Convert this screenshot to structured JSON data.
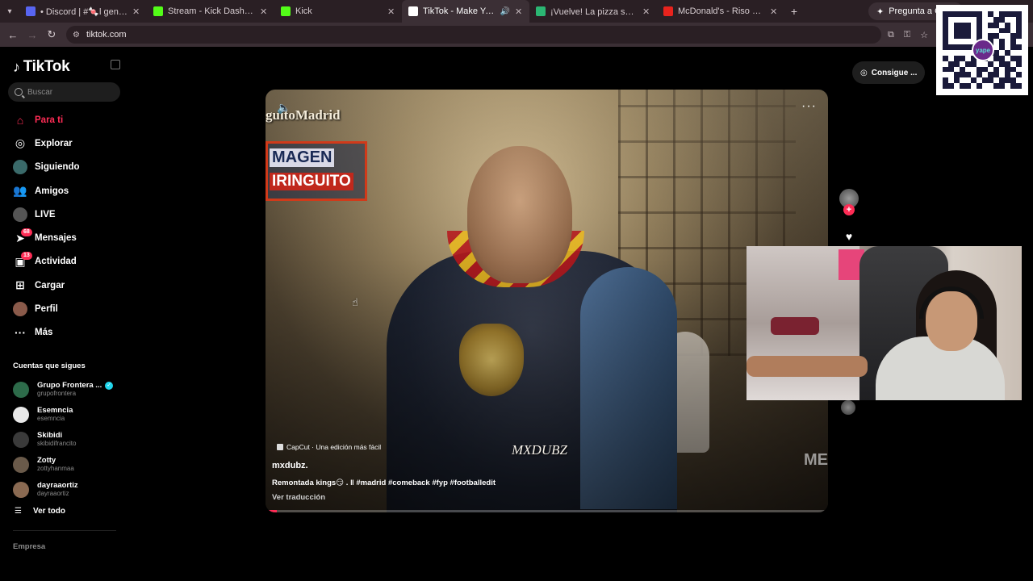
{
  "browser": {
    "tabs": [
      {
        "title": "• Discord | #🍬l general | Clou",
        "favicon_color": "#5865f2",
        "active": false
      },
      {
        "title": "Stream - Kick Dashboard",
        "favicon_color": "#53fc18",
        "active": false
      },
      {
        "title": "Kick",
        "favicon_color": "#53fc18",
        "active": false
      },
      {
        "title": "TikTok - Make Your Day",
        "favicon_color": "#ffffff",
        "active": true
      },
      {
        "title": "¡Vuelve! La pizza se enfría 🍕🔵",
        "favicon_color": "#2bb673",
        "active": false
      },
      {
        "title": "McDonald's - Riso Precios y Me",
        "favicon_color": "#e8231d",
        "active": false
      }
    ],
    "gemini_label": "Pregunta a Gemi",
    "url": "tiktok.com"
  },
  "qr": {
    "logo_text": "yape"
  },
  "sidebar": {
    "brand": "TikTok",
    "search_placeholder": "Buscar",
    "nav": [
      {
        "label": "Para ti",
        "icon": "home-icon",
        "active": true
      },
      {
        "label": "Explorar",
        "icon": "compass-icon",
        "active": false
      },
      {
        "label": "Siguiendo",
        "icon": "following-avatar",
        "active": false
      },
      {
        "label": "Amigos",
        "icon": "friends-icon",
        "active": false
      },
      {
        "label": "LIVE",
        "icon": "live-icon",
        "active": false
      },
      {
        "label": "Mensajes",
        "icon": "messages-icon",
        "active": false,
        "badge": "68"
      },
      {
        "label": "Actividad",
        "icon": "activity-icon",
        "active": false,
        "badge": "13"
      },
      {
        "label": "Cargar",
        "icon": "upload-icon",
        "active": false
      },
      {
        "label": "Perfil",
        "icon": "profile-avatar",
        "active": false
      },
      {
        "label": "Más",
        "icon": "more-icon",
        "active": false
      }
    ],
    "following_title": "Cuentas que sigues",
    "following": [
      {
        "name": "Grupo Frontera ...",
        "user": "grupofrontera",
        "verified": true,
        "avatar_color": "#2d6b4a"
      },
      {
        "name": "Esemncia",
        "user": "esemncia",
        "verified": false,
        "avatar_color": "#e8e8e8"
      },
      {
        "name": "Skibidi",
        "user": "skibidifrancito",
        "verified": false,
        "avatar_color": "#3a3a3a"
      },
      {
        "name": "Zotty",
        "user": "zottyhanmaa",
        "verified": false,
        "avatar_color": "#6a5a4a"
      },
      {
        "name": "dayraaortiz",
        "user": "dayraaortiz",
        "verified": false,
        "avatar_color": "#8a6a52"
      }
    ],
    "see_all": "Ver todo",
    "footer": "Empresa"
  },
  "get_app": "Consigue ...",
  "video": {
    "overlay_brand": "guitoMadrid",
    "overlay_logo_line1": "MAGEN",
    "overlay_logo_line2": "IRINGUITO",
    "watermark": "MXDUBZ",
    "watermark_right": "ME",
    "capcut": "CapCut · Una edición más fácil",
    "username": "mxdubz.",
    "description": "Remontada kings😏 . ‖ #madrid #comeback #fyp #footballedit",
    "translate": "Ver traducción",
    "progress": 0.02
  },
  "colors": {
    "accent": "#fe2c55",
    "verified": "#20d5ec",
    "background": "#000000"
  }
}
